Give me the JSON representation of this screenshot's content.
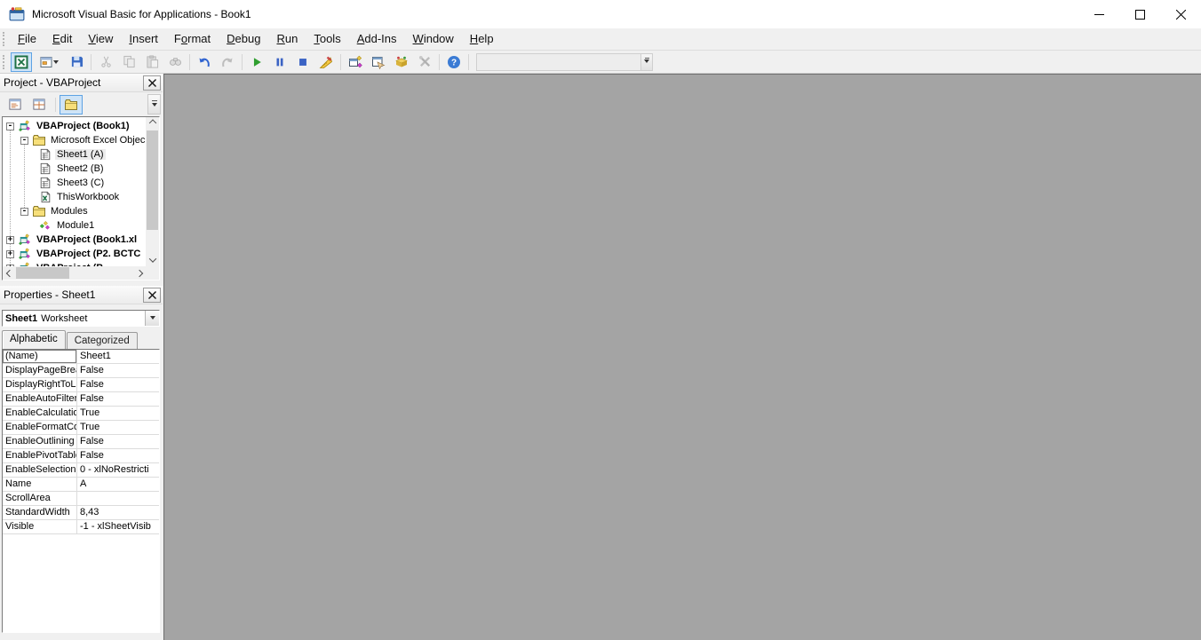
{
  "window": {
    "title": "Microsoft Visual Basic for Applications - Book1",
    "controls": [
      "minimize",
      "maximize",
      "close"
    ]
  },
  "menu": {
    "items": [
      {
        "label": "File",
        "accel": 0
      },
      {
        "label": "Edit",
        "accel": 0
      },
      {
        "label": "View",
        "accel": 0
      },
      {
        "label": "Insert",
        "accel": 0
      },
      {
        "label": "Format",
        "accel": 1
      },
      {
        "label": "Debug",
        "accel": 0
      },
      {
        "label": "Run",
        "accel": 0
      },
      {
        "label": "Tools",
        "accel": 0
      },
      {
        "label": "Add-Ins",
        "accel": 0
      },
      {
        "label": "Window",
        "accel": 0
      },
      {
        "label": "Help",
        "accel": 0
      }
    ]
  },
  "toolbar": {
    "icons": [
      "view-microsoft-excel",
      "insert-userform",
      "save",
      "cut",
      "copy",
      "paste",
      "find",
      "undo",
      "redo",
      "run-sub",
      "break",
      "reset",
      "design-mode",
      "project-explorer",
      "properties-window",
      "object-browser",
      "toolbox",
      "help"
    ],
    "disabled_icons": [
      "cut",
      "copy",
      "paste",
      "find",
      "redo",
      "toolbox"
    ],
    "active_icon": "view-microsoft-excel"
  },
  "project": {
    "title": "Project - VBAProject",
    "tools": [
      "view-code",
      "view-object",
      "toggle-folders"
    ],
    "active_tool": "toggle-folders",
    "tree": [
      {
        "label": "VBAProject (Book1)",
        "expand": "-",
        "bold": true,
        "icon": "project"
      },
      {
        "label": "Microsoft Excel Objec",
        "expand": "-",
        "icon": "folder"
      },
      {
        "label": "Sheet1 (A)",
        "icon": "worksheet",
        "selected": true
      },
      {
        "label": "Sheet2 (B)",
        "icon": "worksheet"
      },
      {
        "label": "Sheet3 (C)",
        "icon": "worksheet"
      },
      {
        "label": "ThisWorkbook",
        "icon": "workbook"
      },
      {
        "label": "Modules",
        "expand": "-",
        "icon": "folder"
      },
      {
        "label": "Module1",
        "icon": "module"
      },
      {
        "label": "VBAProject (Book1.xl",
        "expand": "+",
        "bold": true,
        "icon": "project"
      },
      {
        "label": "VBAProject (P2. BCTC",
        "expand": "+",
        "bold": true,
        "icon": "project"
      },
      {
        "label": "VBAProject (B",
        "expand": "+",
        "bold": true,
        "icon": "project"
      }
    ]
  },
  "properties": {
    "title": "Properties - Sheet1",
    "selector": {
      "object": "Sheet1",
      "type": "Worksheet"
    },
    "tabs": [
      "Alphabetic",
      "Categorized"
    ],
    "rows": [
      {
        "name": "(Name)",
        "value": "Sheet1"
      },
      {
        "name": "DisplayPageBreak",
        "value": "False"
      },
      {
        "name": "DisplayRightToLef",
        "value": "False"
      },
      {
        "name": "EnableAutoFilter",
        "value": "False"
      },
      {
        "name": "EnableCalculation",
        "value": "True"
      },
      {
        "name": "EnableFormatCon",
        "value": "True"
      },
      {
        "name": "EnableOutlining",
        "value": "False"
      },
      {
        "name": "EnablePivotTable",
        "value": "False"
      },
      {
        "name": "EnableSelection",
        "value": "0 - xlNoRestricti"
      },
      {
        "name": "Name",
        "value": "A"
      },
      {
        "name": "ScrollArea",
        "value": ""
      },
      {
        "name": "StandardWidth",
        "value": "8,43"
      },
      {
        "name": "Visible",
        "value": "-1 - xlSheetVisib"
      }
    ]
  },
  "colors": {
    "workspace": "#a4a4a4",
    "toolbar_highlight_bg": "#cfe4f7",
    "toolbar_highlight_border": "#5ea3e4",
    "run_green": "#2f9e2f",
    "excel_green": "#1e7145",
    "blue_icon": "#3b63c4"
  }
}
